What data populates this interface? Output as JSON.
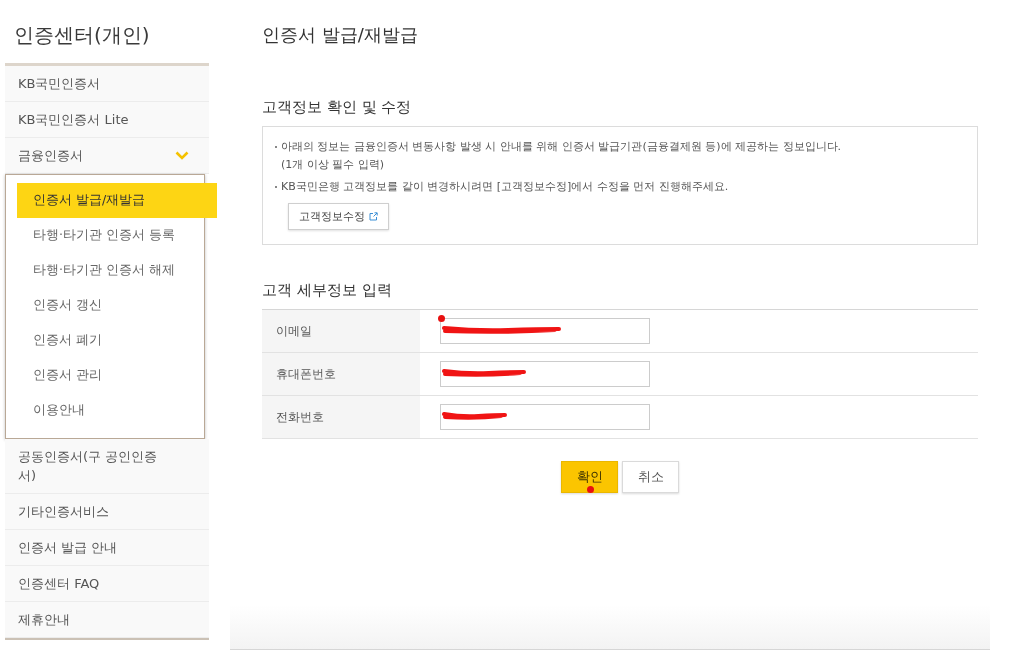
{
  "sidebar": {
    "title": "인증센터(개인)",
    "items": [
      {
        "label": "KB국민인증서",
        "selected": false
      },
      {
        "label": "KB국민인증서 Lite",
        "selected": false
      },
      {
        "label": "금융인증서",
        "selected": false,
        "expanded": true,
        "children": [
          {
            "label": "인증서 발급/재발급",
            "selected": true
          },
          {
            "label": "타행·타기관 인증서 등록",
            "selected": false
          },
          {
            "label": "타행·타기관 인증서 해제",
            "selected": false
          },
          {
            "label": "인증서 갱신",
            "selected": false
          },
          {
            "label": "인증서 폐기",
            "selected": false
          },
          {
            "label": "인증서 관리",
            "selected": false
          },
          {
            "label": "이용안내",
            "selected": false
          }
        ]
      },
      {
        "label": "공동인증서(구 공인인증서)",
        "selected": false
      },
      {
        "label": "기타인증서비스",
        "selected": false
      },
      {
        "label": "인증서 발급 안내",
        "selected": false
      },
      {
        "label": "인증센터 FAQ",
        "selected": false
      },
      {
        "label": "제휴안내",
        "selected": false
      }
    ]
  },
  "main": {
    "title": "인증서 발급/재발급",
    "info_section": {
      "heading": "고객정보 확인 및 수정",
      "notes": [
        "아래의 정보는 금융인증서 변동사항 발생 시 안내를 위해 인증서 발급기관(금융결제원 등)에 제공하는 정보입니다.\n(1개 이상 필수 입력)",
        "KB국민은행 고객정보를 같이 변경하시려면 [고객정보수정]에서 수정을 먼저 진행해주세요."
      ],
      "button": "고객정보수정"
    },
    "detail_section": {
      "heading": "고객 세부정보 입력",
      "fields": [
        {
          "label": "이메일",
          "redacted": true,
          "marked": true
        },
        {
          "label": "휴대폰번호",
          "redacted": true,
          "marked": false
        },
        {
          "label": "전화번호",
          "redacted": true,
          "marked": false
        }
      ]
    },
    "actions": [
      {
        "label": "확인",
        "kind": "primary",
        "marked": true
      },
      {
        "label": "취소",
        "kind": "secondary",
        "marked": false
      }
    ]
  }
}
